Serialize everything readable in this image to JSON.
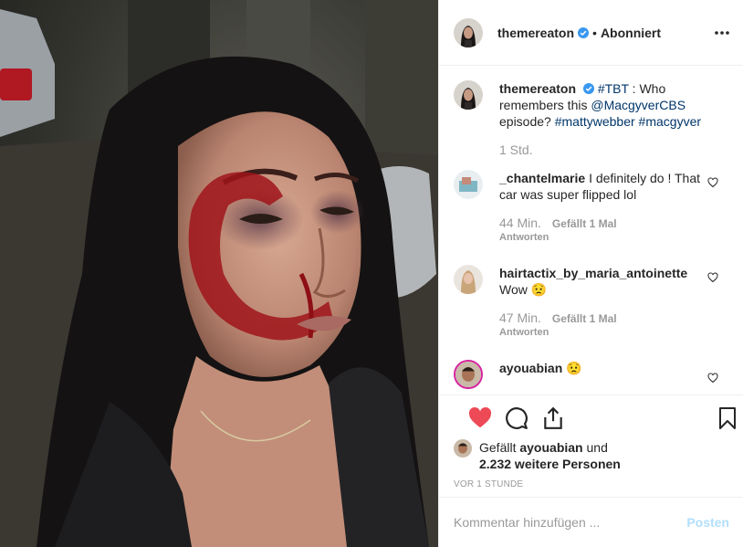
{
  "post": {
    "username": "themereaton",
    "follow_status": "Abonniert",
    "dot": "•"
  },
  "caption": {
    "username": "themereaton",
    "tag1": "#TBT",
    "text1": " : Who remembers this ",
    "mention": "@MacgyverCBS",
    "text2": " episode? ",
    "tag2": "#mattywebber",
    "tag3": "#macgyver",
    "time": "1 Std."
  },
  "comments": [
    {
      "username": "_chantelmarie",
      "text": "I definitely do ! That car was super flipped lol",
      "time": "44 Min.",
      "likes": "Gefällt 1 Mal",
      "reply": "Antworten"
    },
    {
      "username": "hairtactix_by_maria_antoinette",
      "text": "Wow 😟",
      "time": "47 Min.",
      "likes": "Gefällt 1 Mal",
      "reply": "Antworten"
    },
    {
      "username": "ayouabian",
      "text": "😟"
    }
  ],
  "likes": {
    "prefix": "Gefällt ",
    "user": "ayouabian",
    "mid": " und",
    "count": "2.232 weitere Personen"
  },
  "posted_ago": "VOR 1 STUNDE",
  "comment_input": {
    "placeholder": "Kommentar hinzufügen ...",
    "post_label": "Posten"
  },
  "colors": {
    "like_red": "#ed4956",
    "verified_blue": "#3897f0",
    "link_blue": "#003569",
    "muted": "#999999"
  },
  "icons": [
    "more-icon",
    "verified-icon",
    "heart-outline-icon",
    "heart-filled-icon",
    "comment-icon",
    "share-icon",
    "bookmark-icon"
  ]
}
